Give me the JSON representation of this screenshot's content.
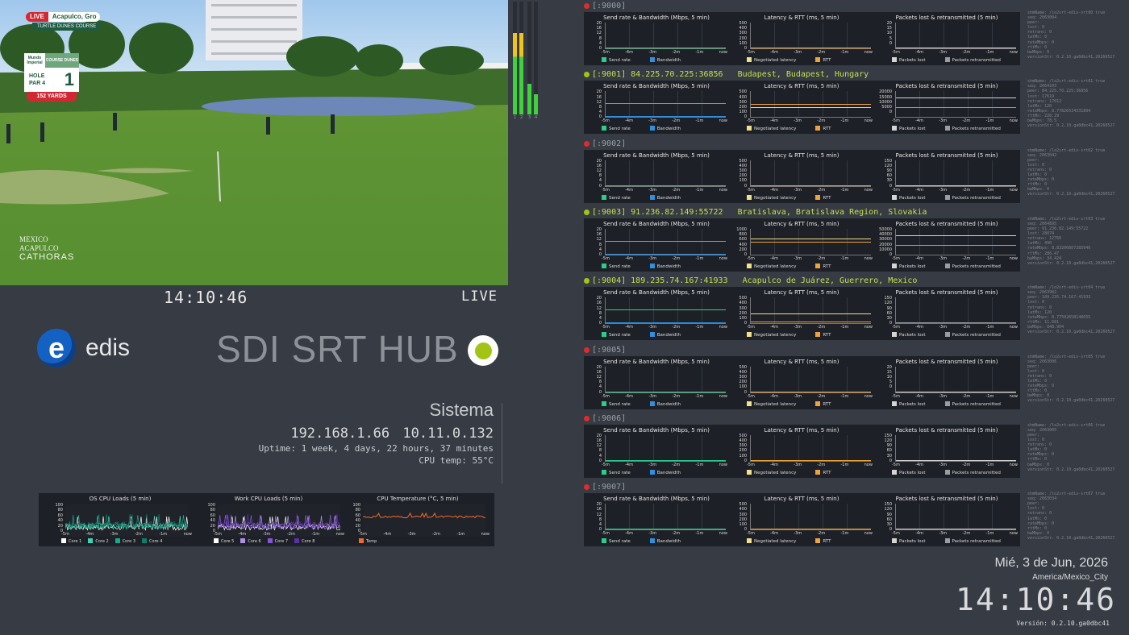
{
  "broadcast": {
    "live_tag": "LIVE",
    "location": "Acapulco, Gro",
    "course": "TURTLE DUNES COURSE",
    "hole_sponsor": "Mundo Imperial",
    "hole_course": "COURSE DUNES",
    "hole_label": "HOLE",
    "par_label": "PAR 4",
    "hole_number": "1",
    "yards": "152 YARDS",
    "watermark_line1": "MEXICO",
    "watermark_line2": "ACAPULCO",
    "watermark_line3": "CATHORAS"
  },
  "vu_meter": {
    "channels": [
      "1",
      "2",
      "3",
      "4"
    ],
    "levels": [
      0.72,
      0.72,
      0.27,
      0.18
    ]
  },
  "video_status": {
    "clock": "14:10:46",
    "live_label": "LIVE"
  },
  "brand": {
    "logo_letter": "e",
    "name": "edis",
    "title": "SDI SRT HUB",
    "status_color": "#a3c414"
  },
  "sistema": {
    "title": "Sistema",
    "ip1": "192.168.1.66",
    "ip2": "10.11.0.132",
    "uptime": "Uptime: 1 week, 4 days, 22 hours, 37 minutes",
    "cpu_temp": "CPU temp:  55°C"
  },
  "cpu_graphs": [
    {
      "title": "OS CPU Loads (5 min)",
      "yticks": [
        "100",
        "80",
        "60",
        "40",
        "20",
        "0"
      ],
      "xticks": [
        "-5m",
        "-4m",
        "-3m",
        "-2m",
        "-1m",
        "now"
      ],
      "legend": [
        {
          "label": "Core 1",
          "color": "#ffffff"
        },
        {
          "label": "Core 2",
          "color": "#3fd1b3"
        },
        {
          "label": "Core 3",
          "color": "#18a88a"
        },
        {
          "label": "Core 4",
          "color": "#0e7e69"
        }
      ]
    },
    {
      "title": "Work CPU Loads (5 min)",
      "yticks": [
        "100",
        "80",
        "60",
        "40",
        "20",
        "0"
      ],
      "xticks": [
        "-5m",
        "-4m",
        "-3m",
        "-2m",
        "-1m",
        "now"
      ],
      "legend": [
        {
          "label": "Core 5",
          "color": "#ffffff"
        },
        {
          "label": "Core 6",
          "color": "#b08ee8"
        },
        {
          "label": "Core 7",
          "color": "#8456d6"
        },
        {
          "label": "Core 8",
          "color": "#5b31a8"
        }
      ]
    },
    {
      "title": "CPU Temperature (°C, 5 min)",
      "yticks": [
        "100",
        "80",
        "60",
        "40",
        "20",
        "0"
      ],
      "xticks": [
        "-5m",
        "-4m",
        "-3m",
        "-2m",
        "-1m",
        "now"
      ],
      "legend": [
        {
          "label": "Temp",
          "color": "#f06a2a"
        }
      ]
    }
  ],
  "srt_common": {
    "graph1_title": "Send rate & Bandwidth (Mbps, 5 min)",
    "graph2_title": "Latency & RTT (ms, 5 min)",
    "graph3_title": "Packets lost & retransmitted (5 min)",
    "xticks": [
      "-5m",
      "-4m",
      "-3m",
      "-2m",
      "-1m",
      "now"
    ],
    "legend1": [
      {
        "label": "Send rate",
        "color": "#2ecc8a"
      },
      {
        "label": "Bandwidth",
        "color": "#2f8fe0"
      }
    ],
    "legend2": [
      {
        "label": "Negotiated latency",
        "color": "#f3e08a"
      },
      {
        "label": "RTT",
        "color": "#f0a33a"
      }
    ],
    "legend3": [
      {
        "label": "Packets lost",
        "color": "#d5d5d5"
      },
      {
        "label": "Packets retransmitted",
        "color": "#9a9ea3"
      }
    ]
  },
  "srt_streams": [
    {
      "header": "[:9000]",
      "active": false,
      "led": "#e02b2b",
      "y1": [
        "20",
        "16",
        "12",
        "8",
        "4",
        "0"
      ],
      "y2": [
        "500",
        "400",
        "300",
        "200",
        "100",
        "0"
      ],
      "y3": [
        "20",
        "15",
        "10",
        "5",
        "0"
      ],
      "side": [
        "shmName: /lo2srt-edis-srt00 true",
        "seq: 2063004",
        "peer:",
        "lost: 0",
        "retrans: 0",
        "latMs: 0",
        "rateMbps: 0",
        "rttMs: 0",
        "bwMbps: 0",
        "versionStr: 0.2.10.ga0dbc41,20260527"
      ]
    },
    {
      "header": "[:9001] 84.225.70.225:36856   Budapest, Budapest, Hungary",
      "active": true,
      "led": "#a3c414",
      "y1": [
        "20",
        "16",
        "12",
        "8",
        "4",
        "0"
      ],
      "y2": [
        "500",
        "400",
        "300",
        "200",
        "100",
        "0"
      ],
      "y3": [
        "20000",
        "15000",
        "10000",
        "5000",
        "0"
      ],
      "side": [
        "shmName: /lo2srt-edis-srt01 true",
        "seq: 2064103",
        "peer: 84.225.70.225:36856",
        "lost: 17619",
        "retrans: 17612",
        "latMs: 120",
        "rateMbps: 8.77826534331804",
        "rttMs: 228.29",
        "bwMbps: 78.5",
        "versionStr: 0.2.10.ga0dbc41,20260527"
      ]
    },
    {
      "header": "[:9002]",
      "active": false,
      "led": "#e02b2b",
      "y1": [
        "20",
        "16",
        "12",
        "8",
        "4",
        "0"
      ],
      "y2": [
        "500",
        "400",
        "300",
        "200",
        "100",
        "0"
      ],
      "y3": [
        "150",
        "120",
        "90",
        "60",
        "30",
        "0"
      ],
      "side": [
        "shmName: /lo2srt-edis-srt02 true",
        "seq: 2063042",
        "peer:",
        "lost: 0",
        "retrans: 0",
        "latMs: 0",
        "rateMbps: 0",
        "rttMs: 0",
        "bwMbps: 0",
        "versionStr: 0.2.10.ga0dbc41,20260527"
      ]
    },
    {
      "header": "[:9003] 91.236.82.149:55722   Bratislava, Bratislava Region, Slovakia",
      "active": true,
      "led": "#a3c414",
      "y1": [
        "20",
        "16",
        "12",
        "8",
        "4",
        "0"
      ],
      "y2": [
        "1000",
        "800",
        "600",
        "400",
        "200",
        "0"
      ],
      "y3": [
        "50000",
        "40000",
        "30000",
        "20000",
        "10000",
        "0"
      ],
      "side": [
        "shmName: /lo2srt-edis-srt03 true",
        "seq: 2064895",
        "peer: 91.236.82.149:55722",
        "lost: 28074",
        "retrans: 12760",
        "latMs: 490",
        "rateMbps: 8.83200807285946",
        "rttMs: 286.47",
        "bwMbps: 34.424",
        "versionStr: 0.2.10.ga0dbc41,20260527"
      ]
    },
    {
      "header": "[:9004] 189.235.74.167:41933   Acapulco de Juárez, Guerrero, Mexico",
      "active": true,
      "led": "#a3c414",
      "y1": [
        "20",
        "16",
        "12",
        "8",
        "4",
        "0"
      ],
      "y2": [
        "500",
        "400",
        "300",
        "200",
        "100",
        "0"
      ],
      "y3": [
        "150",
        "120",
        "90",
        "60",
        "30",
        "0"
      ],
      "side": [
        "shmName: /lo2srt-edis-srt04 true",
        "seq: 2063982",
        "peer: 189.235.74.167:41933",
        "lost: 0",
        "retrans: 0",
        "latMs: 120",
        "rateMbps: 8.77592658148655",
        "rttMs: 11.681",
        "bwMbps: 848.904",
        "versionStr: 0.2.10.ga0dbc41,20260527"
      ]
    },
    {
      "header": "[:9005]",
      "active": false,
      "led": "#e02b2b",
      "y1": [
        "20",
        "16",
        "12",
        "8",
        "4",
        "0"
      ],
      "y2": [
        "500",
        "400",
        "300",
        "200",
        "100",
        "0"
      ],
      "y3": [
        "20",
        "15",
        "10",
        "5",
        "0"
      ],
      "side": [
        "shmName: /lo2srt-edis-srt05 true",
        "seq: 2063006",
        "peer:",
        "lost: 0",
        "retrans: 0",
        "latMs: 0",
        "rateMbps: 0",
        "rttMs: 0",
        "bwMbps: 0",
        "versionStr: 0.2.10.ga0dbc41,20260527"
      ]
    },
    {
      "header": "[:9006]",
      "active": false,
      "led": "#e02b2b",
      "y1": [
        "20",
        "16",
        "12",
        "8",
        "4",
        "0"
      ],
      "y2": [
        "500",
        "400",
        "300",
        "200",
        "100",
        "0"
      ],
      "y3": [
        "150",
        "120",
        "90",
        "60",
        "30",
        "0"
      ],
      "side": [
        "shmName: /lo2srt-edis-srt06 true",
        "seq: 2063005",
        "peer:",
        "lost: 0",
        "retrans: 0",
        "latMs: 0",
        "rateMbps: 0",
        "rttMs: 0",
        "bwMbps: 0",
        "versionStr: 0.2.10.ga0dbc41,20260527"
      ]
    },
    {
      "header": "[:9007]",
      "active": false,
      "led": "#e02b2b",
      "y1": [
        "20",
        "16",
        "12",
        "8",
        "4",
        "0"
      ],
      "y2": [
        "500",
        "400",
        "300",
        "200",
        "100",
        "0"
      ],
      "y3": [
        "150",
        "120",
        "90",
        "60",
        "30",
        "0"
      ],
      "side": [
        "shmName: /lo2srt-edis-srt07 true",
        "seq: 2063034",
        "peer:",
        "lost: 0",
        "retrans: 0",
        "latMs: 0",
        "rateMbps: 0",
        "rttMs: 0",
        "bwMbps: 0",
        "versionStr: 0.2.10.ga0dbc41,20260527"
      ]
    }
  ],
  "footer": {
    "date": "Mié, 3 de Jun, 2026",
    "timezone": "America/Mexico_City",
    "clock": "14:10:46",
    "version": "Versión: 0.2.10.ga0dbc41"
  }
}
